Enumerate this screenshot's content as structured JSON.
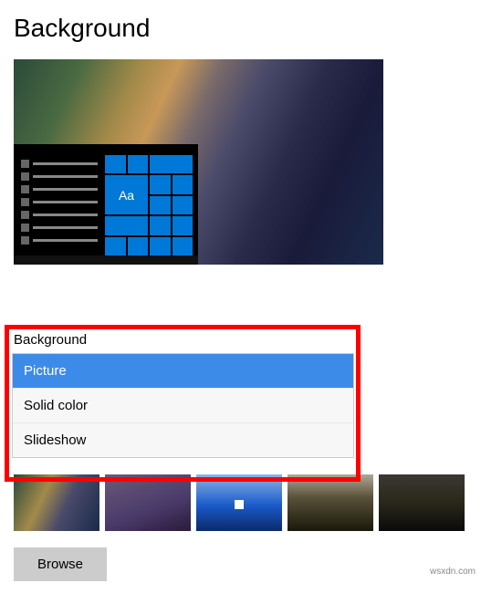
{
  "page": {
    "title": "Background"
  },
  "preview": {
    "sample_text": "Aa"
  },
  "dropdown": {
    "label": "Background",
    "options": [
      {
        "label": "Picture",
        "selected": true
      },
      {
        "label": "Solid color",
        "selected": false
      },
      {
        "label": "Slideshow",
        "selected": false
      }
    ]
  },
  "browse": {
    "label": "Browse"
  },
  "watermark": "wsxdn.com"
}
